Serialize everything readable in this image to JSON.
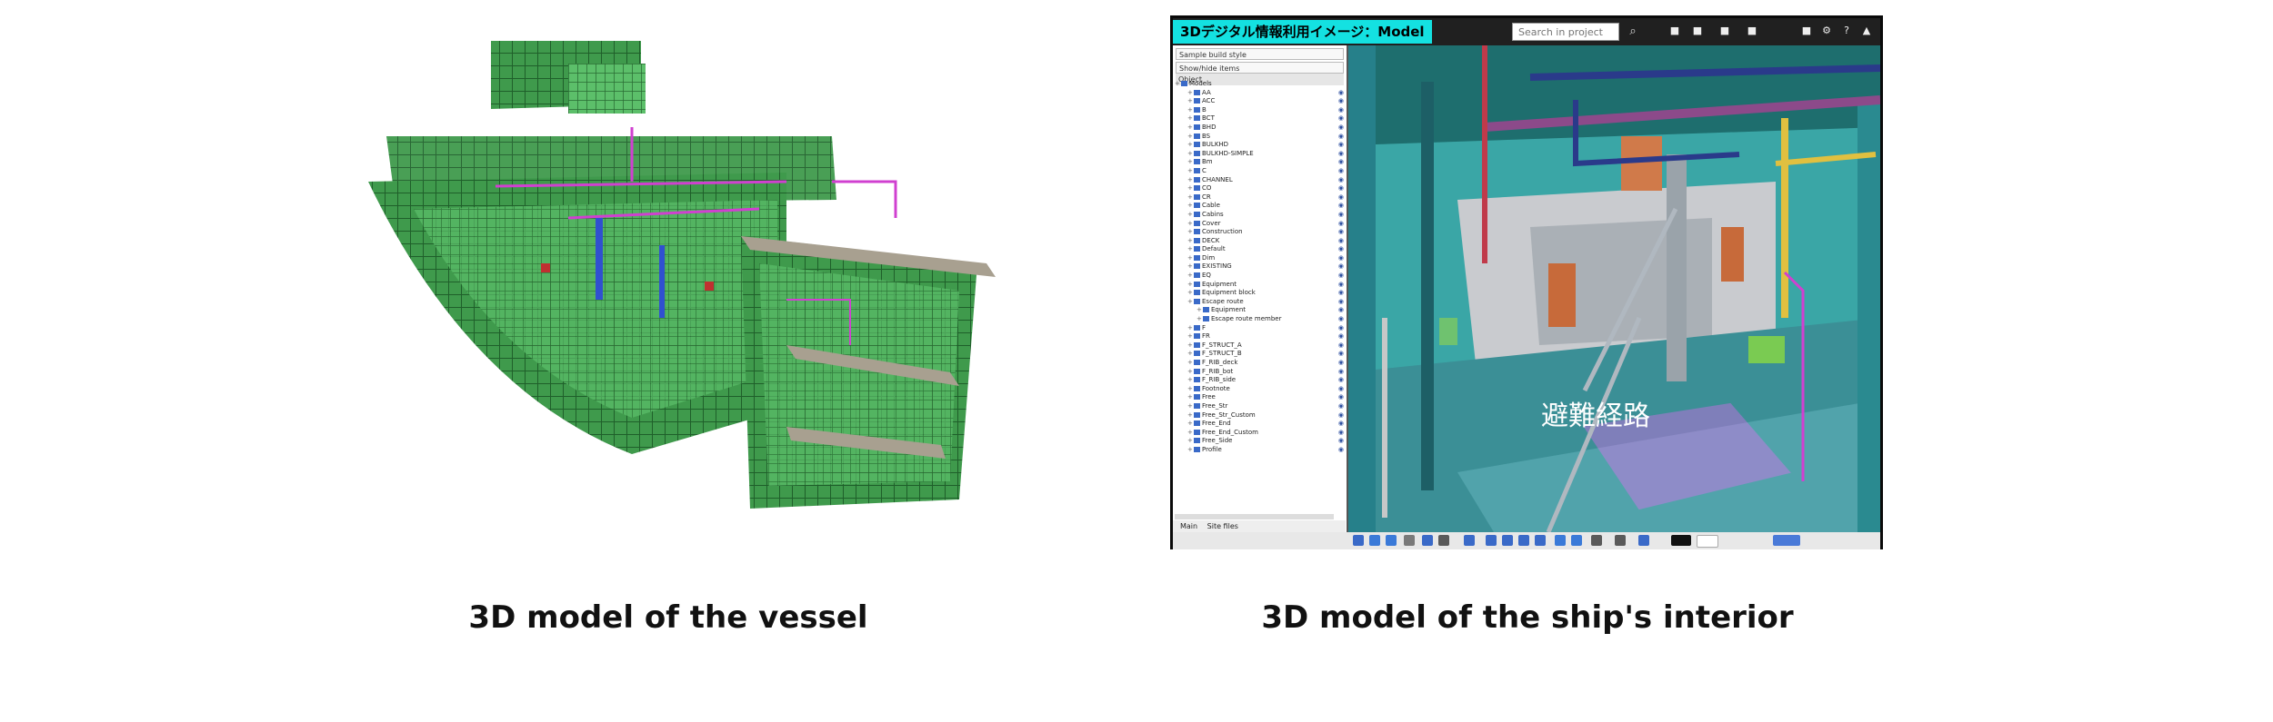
{
  "captions": {
    "left": "3D model of the vessel",
    "right": "3D model of the ship's interior"
  },
  "viewer": {
    "title": "3Dデジタル情報利用イメージ：Model",
    "search_placeholder": "Search in project",
    "scene_label": "避難経路",
    "panel": {
      "select_1": "Sample build style",
      "select_2": "Show/hide items",
      "select_3": "Object"
    },
    "tree_items": [
      "Models",
      "AA",
      "ACC",
      "B",
      "BCT",
      "BHD",
      "BS",
      "BULKHD",
      "BULKHD-SIMPLE",
      "Bm",
      "C",
      "CHANNEL",
      "CO",
      "CR",
      "Cable",
      "Cabins",
      "Cover",
      "Construction",
      "DECK",
      "Default",
      "Dim",
      "EXISTING",
      "EQ",
      "Equipment",
      "Equipment block",
      "Escape route",
      "Equipment",
      "Escape route member",
      "F",
      "FR",
      "F_STRUCT_A",
      "F_STRUCT_B",
      "F_RIB_deck",
      "F_RIB_bot",
      "F_RIB_side",
      "Footnote",
      "Free",
      "Free_Str",
      "Free_Str_Custom",
      "Free_End",
      "Free_End_Custom",
      "Free_Side",
      "Profile"
    ],
    "panel_tabs": [
      "Main",
      "Site files"
    ]
  },
  "colors": {
    "title_accent": "#14e1e1",
    "hull_green": "#2e8b3f",
    "pipe_magenta": "#d040d0",
    "escape_route": "#ff64ff"
  },
  "icons": [
    "search-icon",
    "settings-icon",
    "help-icon",
    "warning-icon"
  ]
}
